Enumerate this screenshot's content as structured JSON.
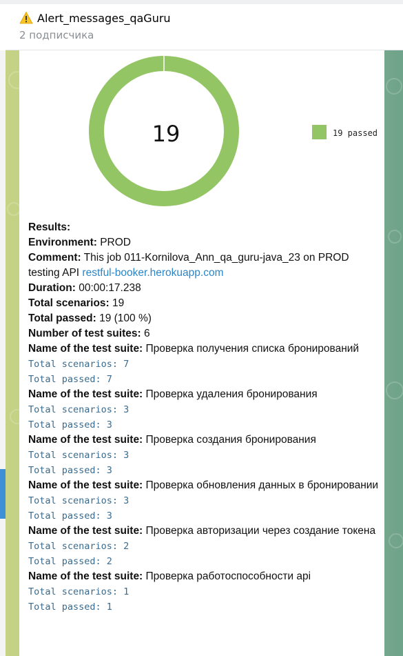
{
  "channel": {
    "title": "Alert_messages_qaGuru",
    "subscribers": "2 подписчика",
    "title_icon": "warning-icon"
  },
  "chart_data": {
    "type": "pie",
    "center_label": "19",
    "slices": [
      {
        "label": "19 passed",
        "value": 19,
        "color": "#93c564"
      }
    ],
    "legend": [
      "19 passed"
    ],
    "legend_placement": "right"
  },
  "report": {
    "results_label": "Results:",
    "environment_label": "Environment:",
    "environment_value": " PROD",
    "comment_label": "Comment:",
    "comment_value": " This job 011-Kornilova_Ann_qa_guru-java_23 on PROD testing API ",
    "comment_link": "restful-booker.herokuapp.com",
    "duration_label": "Duration:",
    "duration_value": " 00:00:17.238",
    "total_scenarios_label": "Total scenarios:",
    "total_scenarios_value": " 19",
    "total_passed_label": "Total passed:",
    "total_passed_value": " 19 (100 %)",
    "suites_count_label": "Number of test suites:",
    "suites_count_value": " 6",
    "suite_name_label": "Name of the test suite:",
    "suites": [
      {
        "name": " Проверка получения списка бронирований",
        "scenarios": "Total scenarios: 7",
        "passed": "Total passed: 7"
      },
      {
        "name": " Проверка удаления бронирования",
        "scenarios": "Total scenarios: 3",
        "passed": "Total passed: 3"
      },
      {
        "name": " Проверка создания бронирования",
        "scenarios": "Total scenarios: 3",
        "passed": "Total passed: 3"
      },
      {
        "name": " Проверка обновления данных в бронировании",
        "scenarios": "Total scenarios: 3",
        "passed": "Total passed: 3"
      },
      {
        "name": " Проверка авторизации через создание токена",
        "scenarios": "Total scenarios: 2",
        "passed": "Total passed: 2"
      },
      {
        "name": " Проверка работоспособности api",
        "scenarios": "Total scenarios: 1",
        "passed": "Total passed: 1"
      }
    ]
  }
}
